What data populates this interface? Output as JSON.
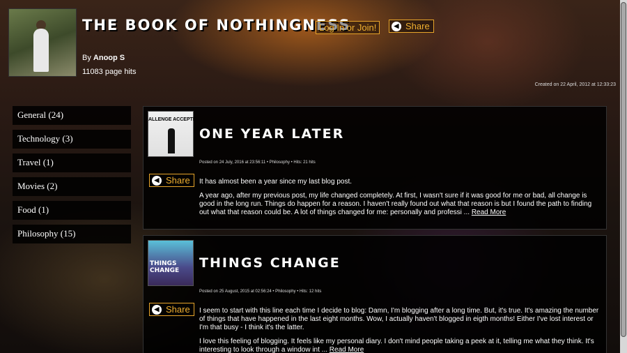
{
  "blog": {
    "title": "THE BOOK OF NOTHINGNESS",
    "login_label": "Log In or Join!",
    "share_label": "Share",
    "by_prefix": "By",
    "author": "Anoop S",
    "hits": "11083 page hits",
    "created": "Created on 22 April, 2012 at 12:33:23"
  },
  "sidebar": {
    "categories": [
      "General (24)",
      "Technology (3)",
      "Travel (1)",
      "Movies (2)",
      "Food (1)",
      "Philosophy (15)"
    ]
  },
  "posts": [
    {
      "title": "ONE YEAR LATER",
      "thumb_caption": "ALLENGE ACCEPTE",
      "meta": "Posted on 24 July, 2016 at 23:56:11 • Philosophy • Hits: 21 hits",
      "share_label": "Share",
      "para1": "It has almost been a year since my last blog post.",
      "para2": "A year ago, after my previous post, my life changed completely. At first, I wasn't sure if it was good for me or bad, all change is good in the long run. Things do happen for a reason. I haven't really found out what that reason is but I found the path to finding out what that reason could be. A lot of things changed for me: personally and professi ...",
      "read_more": "Read More"
    },
    {
      "title": "THINGS CHANGE",
      "thumb_caption": "THINGS CHANGE",
      "meta": "Posted on 25 August, 2015 at 02:56:24 • Philosophy • Hits: 12 hits",
      "share_label": "Share",
      "para1": "I seem to start with this line each time I decide to blog: Damn, I'm blogging after a long time. But, it's true. It's amazing the number of things that have happened in the last eight months. Wow, I actually haven't blogged in eigth months! Either I've lost interest or I'm that busy - I think it's the latter.",
      "para2": "I love this feeling of blogging. It feels like my personal diary. I don't mind people taking a peek at it, telling me what they think. It's interesting to look through a window int ...",
      "read_more": "Read More"
    }
  ]
}
